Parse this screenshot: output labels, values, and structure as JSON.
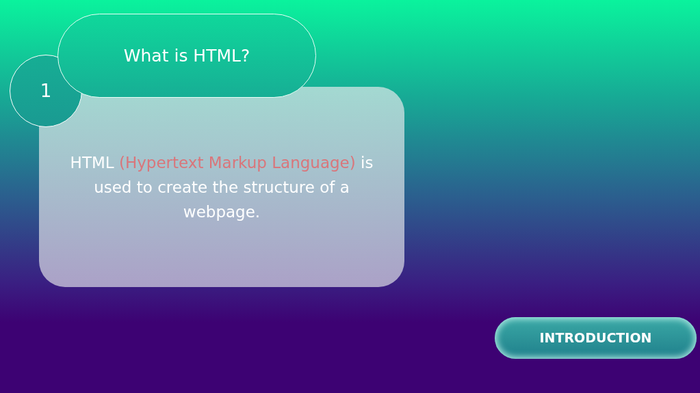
{
  "step": {
    "number": "1",
    "title": "What is HTML?"
  },
  "card": {
    "segments": [
      {
        "text": "HTML ",
        "highlight": false
      },
      {
        "text": "(Hypertext Markup Language)",
        "highlight": true
      },
      {
        "text": " is used to create the structure of a webpage.",
        "highlight": false
      }
    ]
  },
  "button": {
    "label": "INTRODUCTION"
  }
}
